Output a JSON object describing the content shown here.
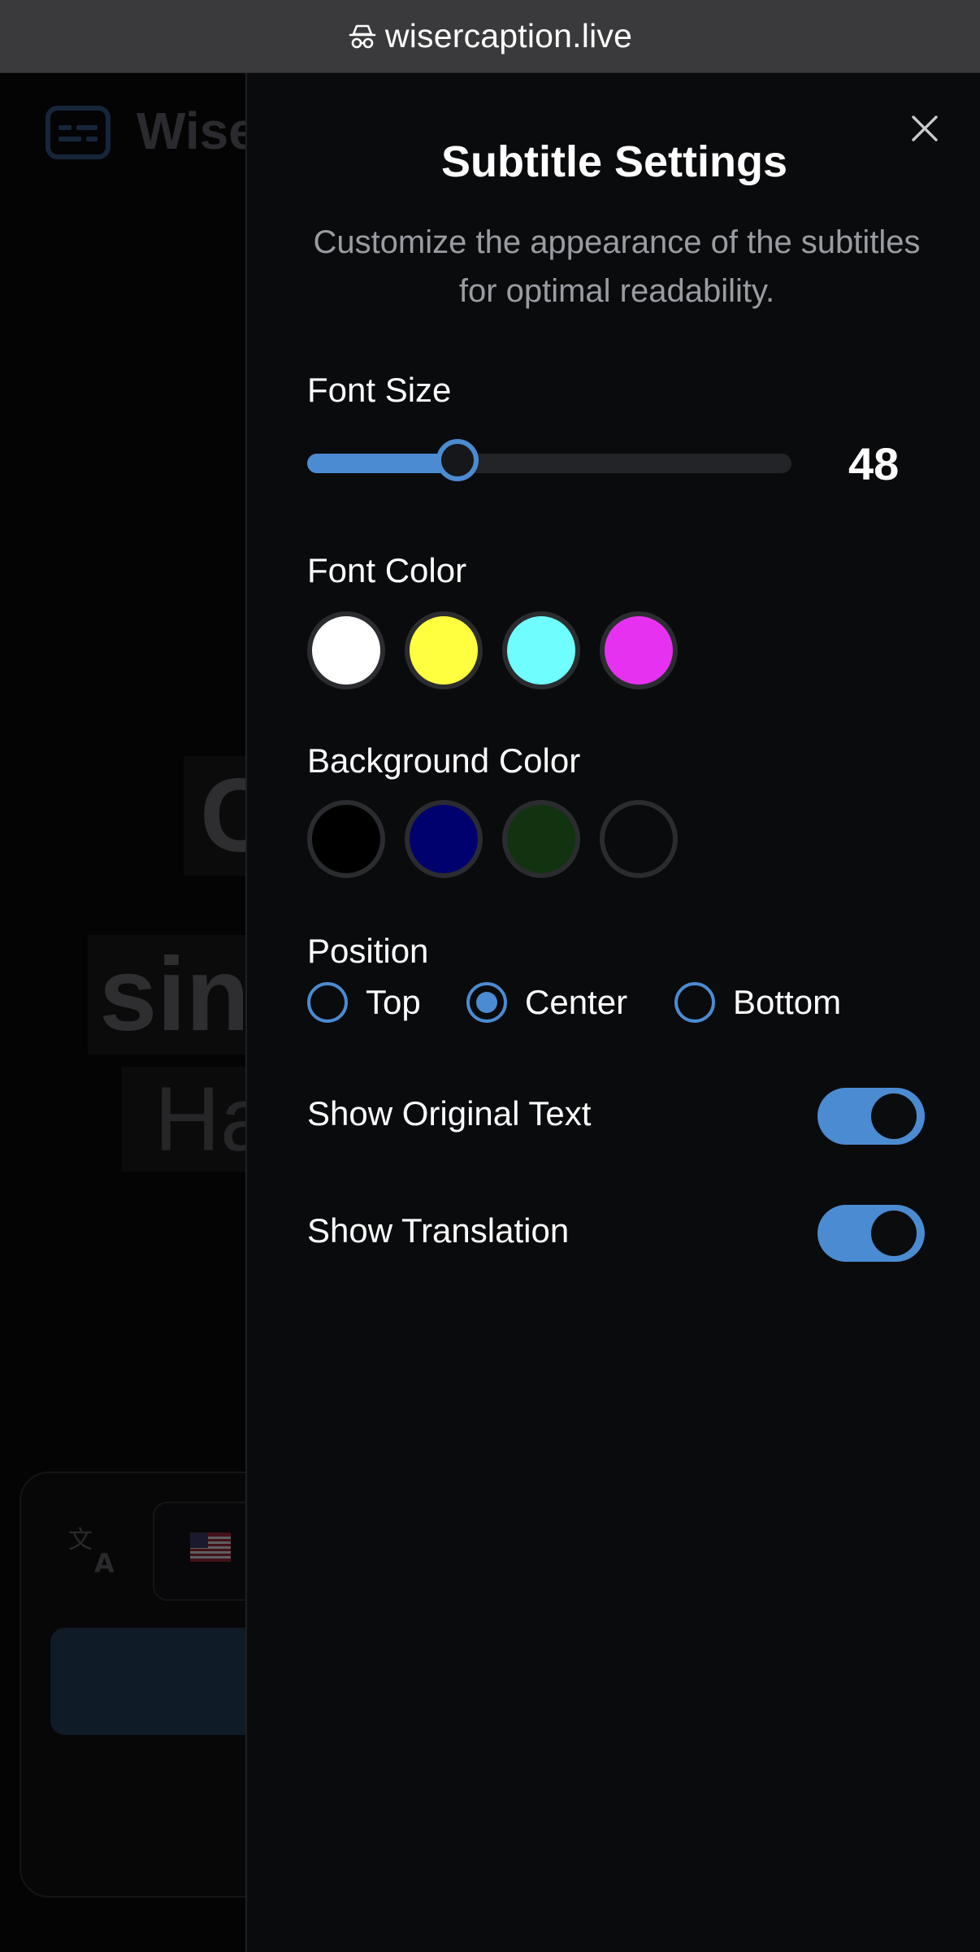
{
  "browser": {
    "url": "wisercaption.live",
    "lock_icon": "incognito-icon"
  },
  "background_app": {
    "brand": "Wise",
    "line1": "C",
    "line2": "sin",
    "line3": "Ha",
    "flag": "🇺🇸"
  },
  "settings": {
    "title": "Subtitle Settings",
    "description": "Customize the appearance of the subtitles for optimal readability.",
    "font_size": {
      "label": "Font Size",
      "value": "48",
      "slider_fraction": 0.31
    },
    "font_color": {
      "label": "Font Color",
      "options": [
        "#ffffff",
        "#ffff40",
        "#6ffdfd",
        "#e632f0"
      ]
    },
    "background_color": {
      "label": "Background Color",
      "options": [
        "#000000",
        "#00006e",
        "#123310",
        "#0a0b0d"
      ]
    },
    "position": {
      "label": "Position",
      "options": [
        "Top",
        "Center",
        "Bottom"
      ],
      "selected": "Center"
    },
    "show_original_text": {
      "label": "Show Original Text",
      "enabled": true
    },
    "show_translation": {
      "label": "Show Translation",
      "enabled": true
    },
    "accent_color": "#4b8bd1"
  }
}
